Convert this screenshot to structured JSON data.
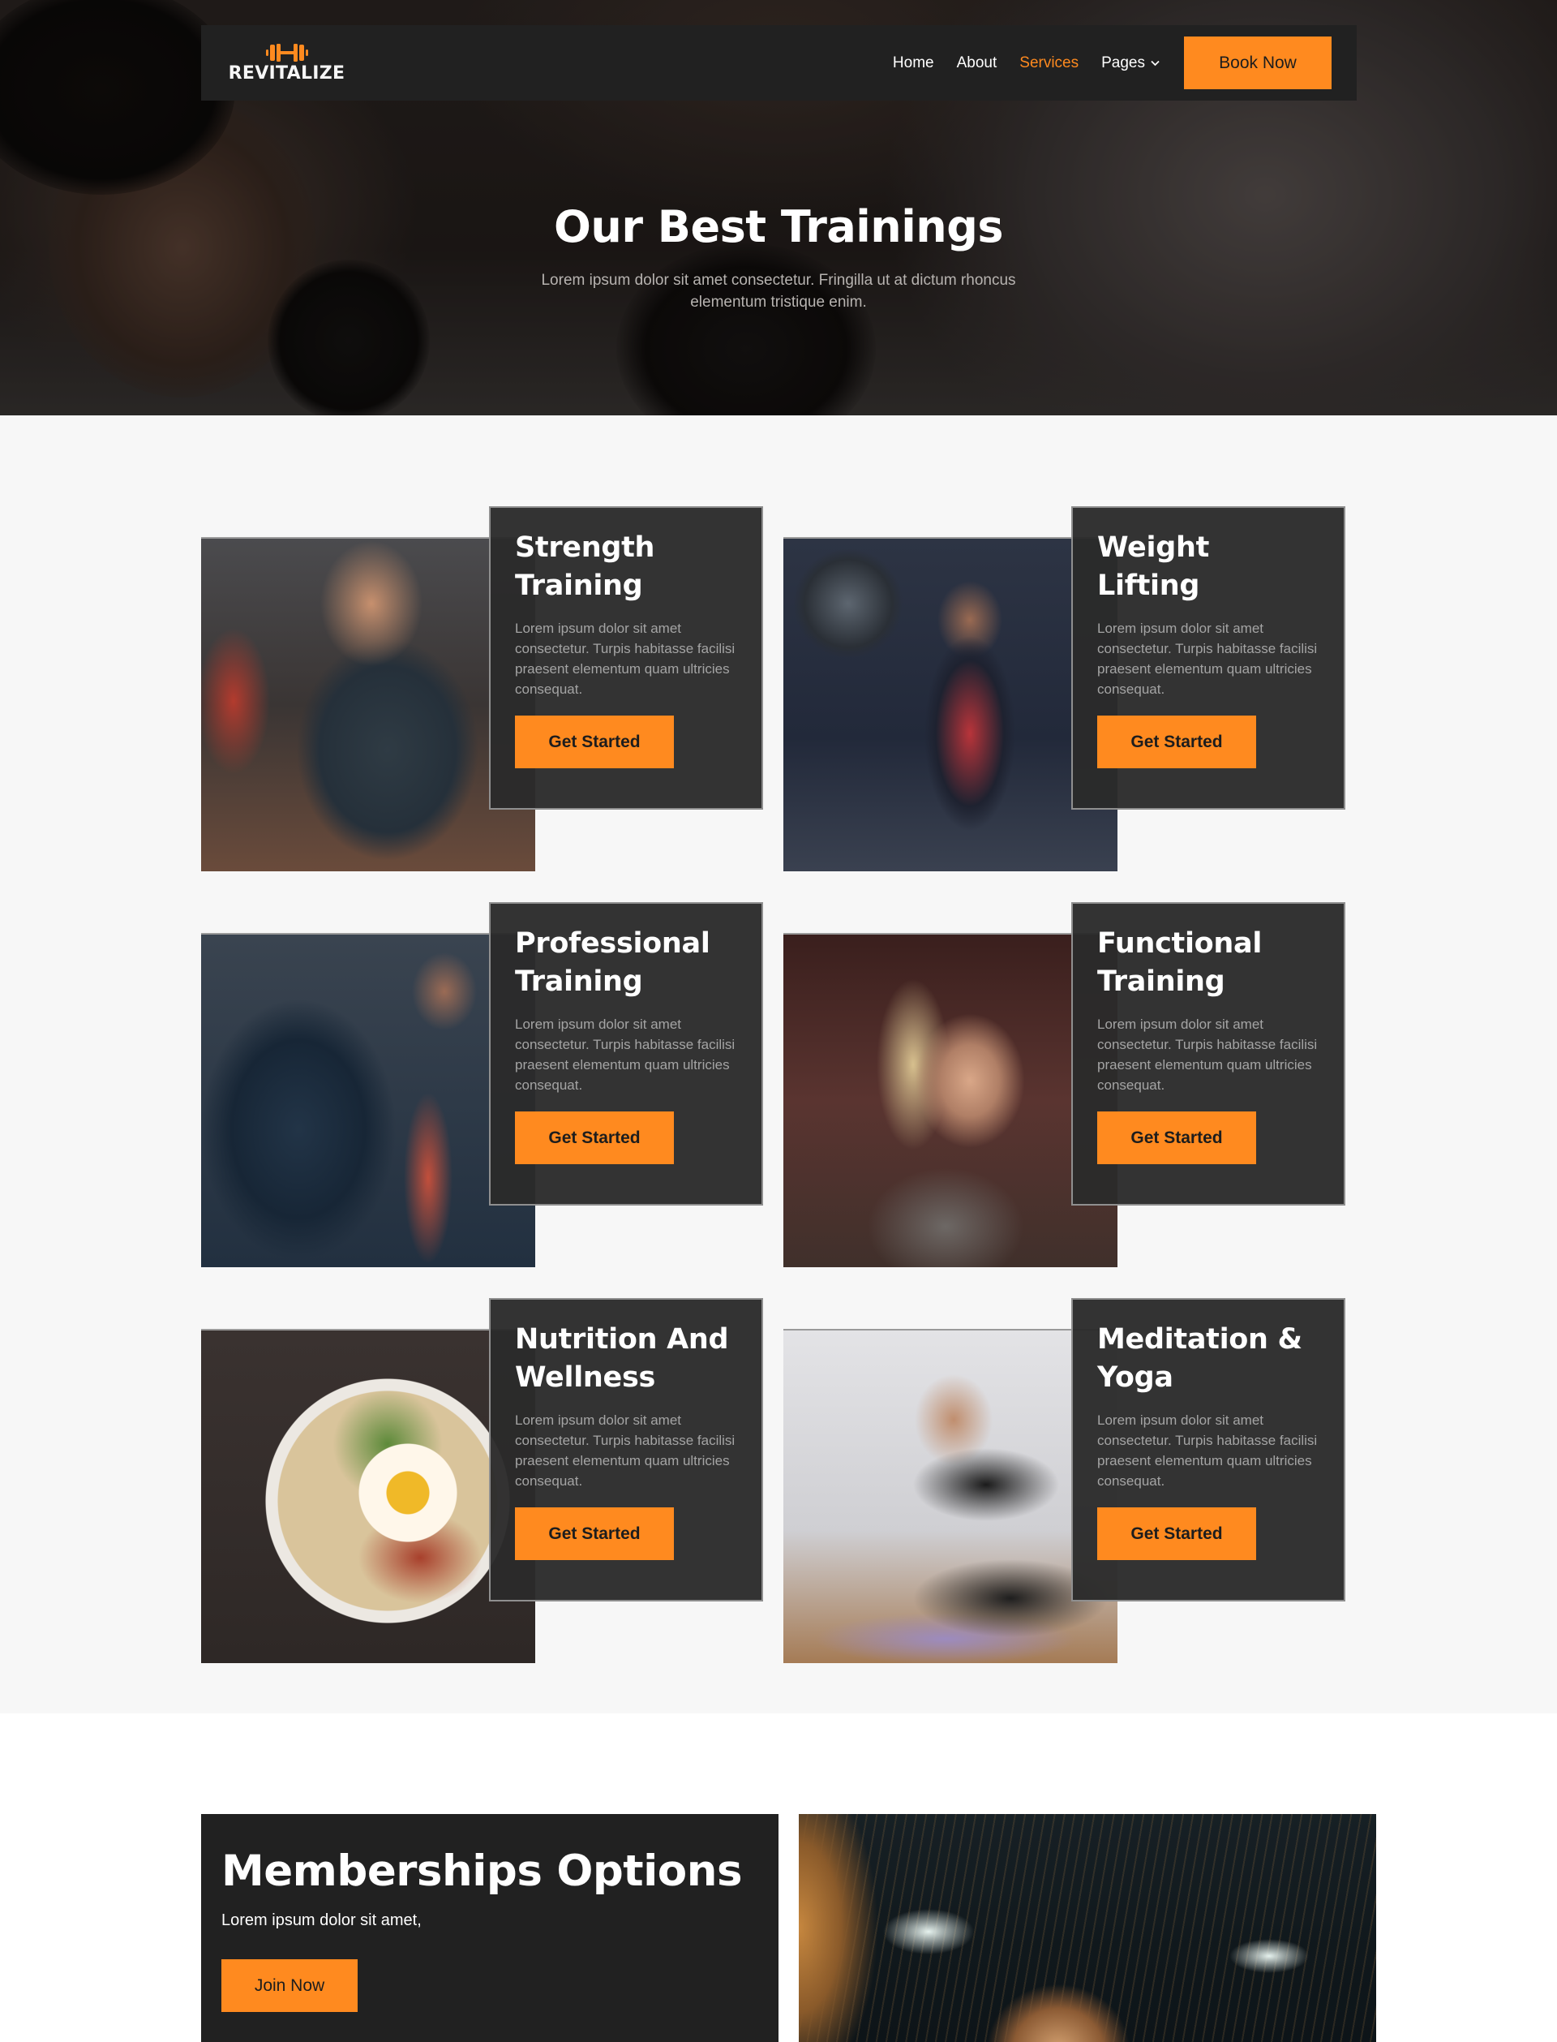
{
  "brand": {
    "name": "REVITALIZE",
    "logo_icon": "dumbbell-icon",
    "accent_color": "#ff8a1f",
    "dark_color": "#212121"
  },
  "nav": {
    "links": [
      {
        "label": "Home",
        "active": false
      },
      {
        "label": "About",
        "active": false
      },
      {
        "label": "Services",
        "active": true
      },
      {
        "label": "Pages",
        "active": false,
        "has_dropdown": true
      }
    ],
    "cta_label": "Book Now"
  },
  "hero": {
    "title": "Our Best Trainings",
    "subtitle": "Lorem ipsum dolor sit amet consectetur. Fringilla ut at dictum rhoncus elementum tristique enim."
  },
  "services": [
    {
      "title": "Strength Training",
      "description": "Lorem ipsum dolor sit amet consectetur. Turpis habitasse facilisi praesent elementum quam ultricies consequat.",
      "button": "Get Started",
      "image": "man-battle-ropes-photo"
    },
    {
      "title": "Weight Lifting",
      "description": "Lorem ipsum dolor sit amet consectetur. Turpis habitasse facilisi praesent elementum quam ultricies consequat.",
      "button": "Get Started",
      "image": "barbell-lunge-photo"
    },
    {
      "title": "Professional Training",
      "description": "Lorem ipsum dolor sit amet consectetur. Turpis habitasse facilisi praesent elementum quam ultricies consequat.",
      "button": "Get Started",
      "image": "woman-tire-flip-photo"
    },
    {
      "title": "Functional Training",
      "description": "Lorem ipsum dolor sit amet consectetur. Turpis habitasse facilisi praesent elementum quam ultricies consequat.",
      "button": "Get Started",
      "image": "woman-workout-class-photo"
    },
    {
      "title": "Nutrition And Wellness",
      "description": "Lorem ipsum dolor sit amet consectetur. Turpis habitasse facilisi praesent elementum quam ultricies consequat.",
      "button": "Get Started",
      "image": "oatmeal-egg-bacon-photo"
    },
    {
      "title": "Meditation & Yoga",
      "description": "Lorem ipsum dolor sit amet consectetur. Turpis habitasse facilisi praesent elementum quam ultricies consequat.",
      "button": "Get Started",
      "image": "yoga-stretch-photo"
    }
  ],
  "memberships": {
    "title": "Memberships Options",
    "subtitle": "Lorem ipsum dolor sit amet,",
    "button": "Join Now",
    "image": "gym-ceiling-woman-photo"
  }
}
